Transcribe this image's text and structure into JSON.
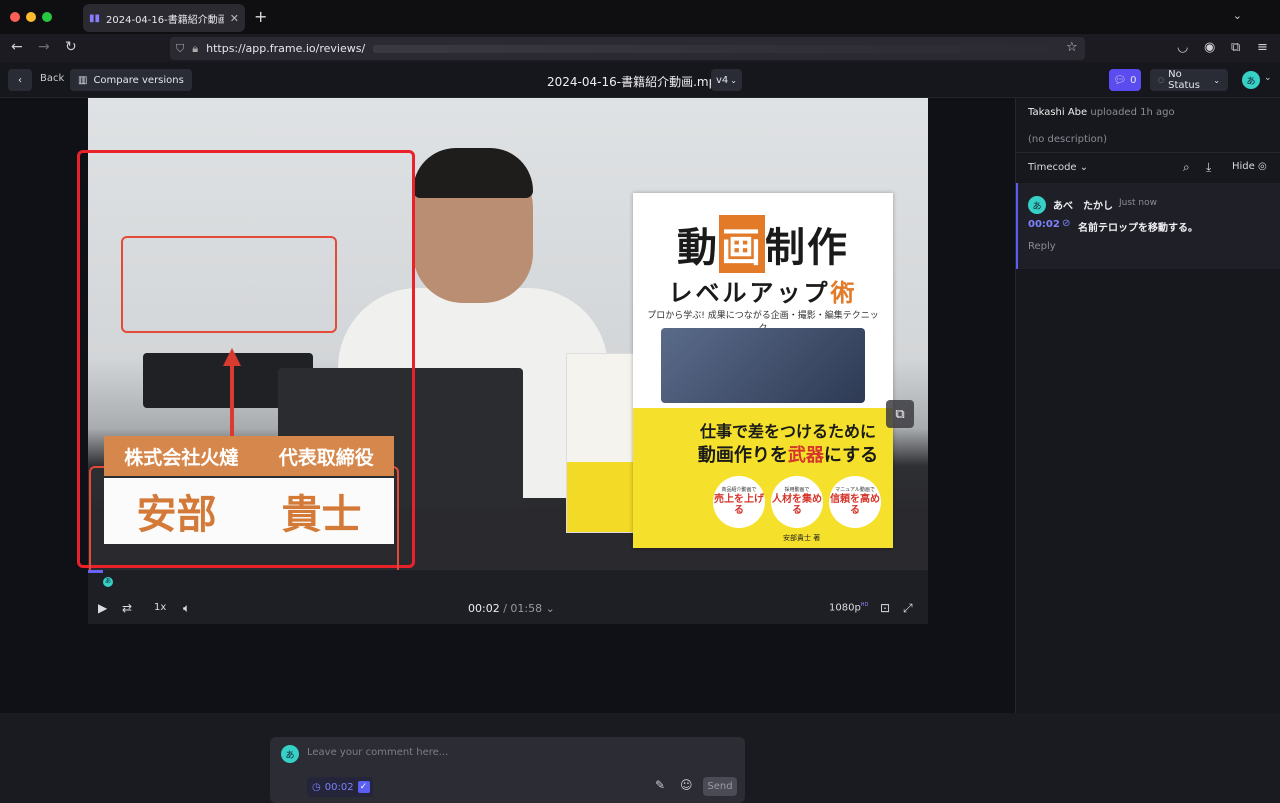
{
  "browser": {
    "tab_title": "2024-04-16-書籍紹介動画.mp4",
    "tab_close": "✕",
    "url": "https://app.frame.io/reviews/",
    "url_host_bold": "frame.io"
  },
  "header": {
    "back_label": "Back",
    "compare_label": "Compare versions",
    "file_title": "2024-04-16-書籍紹介動画.mp4",
    "version_label": "v4",
    "comment_count": "0",
    "status_label": "No Status",
    "avatar_initial": "あ"
  },
  "video": {
    "lower_third_company": "株式会社火燵",
    "lower_third_role": "代表取締役",
    "lower_third_surname": "安部",
    "lower_third_givenname": "貴士",
    "book": {
      "title_a": "動",
      "title_b": "画",
      "title_c": "制作",
      "subtitle": "レベルアップ",
      "subtitle_accent": "術",
      "tagline": "プロから学ぶ! 成果につながる企画・撮影・編集テクニック",
      "yellow_line1": "仕事で差をつけるために",
      "yellow_line2_a": "動画作りを",
      "yellow_line2_b": "武器",
      "yellow_line2_c": "にする",
      "circle1_cap": "商品紹介動画で",
      "circle1": "売上を上げる",
      "circle2_cap": "採用動画で",
      "circle2": "人材を集める",
      "circle3_cap": "マニュアル動画で",
      "circle3": "信頼を高める",
      "author": "安部貴士 著"
    },
    "progress_fraction": 0.0175
  },
  "controls": {
    "speed": "1x",
    "current_time": "00:02",
    "total_time": "01:58",
    "quality": "1080p",
    "quality_badge": "HD"
  },
  "composer": {
    "avatar_initial": "あ",
    "placeholder": "Leave your comment here...",
    "timecode": "00:02",
    "send_label": "Send"
  },
  "panel": {
    "uploader_name": "Takashi Abe",
    "uploader_action": "uploaded 1h ago",
    "description": "(no description)",
    "timecode_label": "Timecode",
    "hide_label": "Hide",
    "comment": {
      "avatar_initial": "あ",
      "author": "あべ　たかし",
      "time": "Just now",
      "timecode": "00:02",
      "text": "名前テロップを移動する。",
      "reply_label": "Reply"
    }
  }
}
